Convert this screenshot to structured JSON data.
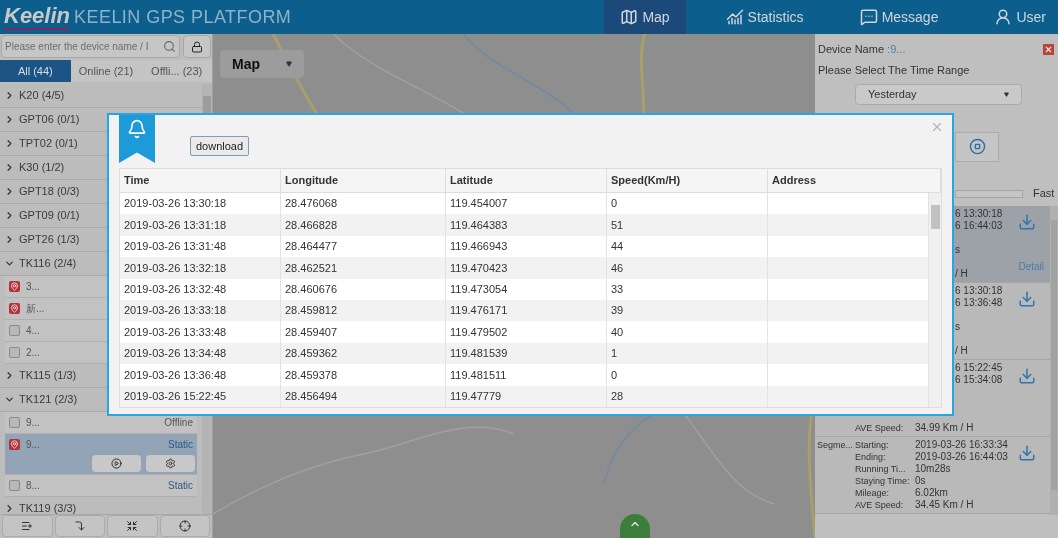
{
  "header": {
    "logo": "Keelin",
    "title": "KEELIN GPS PLATFORM",
    "nav": [
      {
        "label": "Map",
        "selected": true
      },
      {
        "label": "Statistics",
        "selected": false
      },
      {
        "label": "Message",
        "selected": false
      },
      {
        "label": "User",
        "selected": false
      }
    ]
  },
  "sidebar": {
    "search": {
      "placeholder": "Please enter the device name / I"
    },
    "tabs": [
      {
        "label": "All (44)",
        "selected": true
      },
      {
        "label": "Online (21)",
        "selected": false
      },
      {
        "label": "Offli... (23)",
        "selected": false
      }
    ],
    "groups": [
      {
        "label": "K20 (4/5)",
        "expanded": false
      },
      {
        "label": "GPT06 (0/1)",
        "expanded": false
      },
      {
        "label": "TPT02 (0/1)",
        "expanded": false
      },
      {
        "label": "K30 (1/2)",
        "expanded": false
      },
      {
        "label": "GPT18 (0/3)",
        "expanded": false
      },
      {
        "label": "GPT09 (0/1)",
        "expanded": false
      },
      {
        "label": "GPT26 (1/3)",
        "expanded": false
      },
      {
        "label": "TK116 (2/4)",
        "expanded": true,
        "children": [
          {
            "label": "3...",
            "checked": true,
            "selected": false
          },
          {
            "label": "新...",
            "checked": true,
            "selected": false
          },
          {
            "label": "4...",
            "checked": false,
            "selected": false
          },
          {
            "label": "2...",
            "checked": false,
            "selected": false
          }
        ]
      },
      {
        "label": "TK115 (1/3)",
        "expanded": false
      },
      {
        "label": "TK121 (2/3)",
        "expanded": true,
        "children": [
          {
            "label": "9...",
            "checked": false,
            "selected": false,
            "status": "Offline",
            "color": "#555555"
          },
          {
            "label": "9...",
            "checked": true,
            "selected": true,
            "status": "Static",
            "color": "#2a5a88"
          },
          {
            "label": "8...",
            "checked": false,
            "selected": false,
            "status": "Static",
            "color": "#2a5a88"
          }
        ]
      },
      {
        "label": "TK119 (3/3)",
        "expanded": false
      }
    ]
  },
  "map": {
    "type_select": "Map"
  },
  "track_panel": {
    "device_label": "Device Name",
    "device_value": ":9...",
    "time_range_label": "Please Select The Time Range",
    "time_range": "Yesterday",
    "speed_label": "Fast",
    "speed_slider": {
      "level": 0
    },
    "segments": [
      {
        "kind": "covered",
        "selected": true,
        "rows": [
          {
            "value": "6 13:30:18"
          },
          {
            "value": "6 16:44:03"
          },
          {},
          {
            "value": "s"
          },
          {},
          {
            "value": "/ H"
          }
        ],
        "detail": "Detail"
      },
      {
        "kind": "covered",
        "selected": false,
        "rows": [
          {
            "value": "6 13:30:18"
          },
          {
            "value": "6 13:36:48"
          },
          {},
          {
            "value": "s"
          },
          {},
          {
            "value": "/ H"
          }
        ]
      },
      {
        "kind": "covered",
        "selected": false,
        "rows": [
          {
            "value": "6 15:22:45"
          },
          {
            "value": "6 15:34:08"
          },
          {},
          {},
          {},
          {
            "label": "AVE Speed:",
            "value": "34.99 Km / H"
          }
        ]
      },
      {
        "kind": "full",
        "selected": false,
        "title": "Segme...",
        "rows": [
          {
            "label": "Starting:",
            "value": "2019-03-26 16:33:34"
          },
          {
            "label": "Ending:",
            "value": "2019-03-26 16:44:03"
          },
          {
            "label": "Running Ti...",
            "value": "10m28s"
          },
          {
            "label": "Staying Time:",
            "value": "0s"
          },
          {
            "label": "Mileage:",
            "value": "6.02km"
          },
          {
            "label": "AVE Speed:",
            "value": "34.45 Km / H"
          }
        ]
      }
    ]
  },
  "dialog": {
    "download_button": "download",
    "table": {
      "columns": [
        "Time",
        "Longitude",
        "Latitude",
        "Speed(Km/H)",
        "Address"
      ],
      "rows": [
        [
          "2019-03-26 13:30:18",
          "28.476068",
          "119.454007",
          "0"
        ],
        [
          "2019-03-26 13:31:18",
          "28.466828",
          "119.464383",
          "51"
        ],
        [
          "2019-03-26 13:31:48",
          "28.464477",
          "119.466943",
          "44"
        ],
        [
          "2019-03-26 13:32:18",
          "28.462521",
          "119.470423",
          "46"
        ],
        [
          "2019-03-26 13:32:48",
          "28.460676",
          "119.473054",
          "33"
        ],
        [
          "2019-03-26 13:33:18",
          "28.459812",
          "119.476171",
          "39"
        ],
        [
          "2019-03-26 13:33:48",
          "28.459407",
          "119.479502",
          "40"
        ],
        [
          "2019-03-26 13:34:48",
          "28.459362",
          "119.481539",
          "1"
        ],
        [
          "2019-03-26 13:36:48",
          "28.459378",
          "119.481511",
          "0"
        ],
        [
          "2019-03-26 15:22:45",
          "28.456494",
          "119.47779",
          "28"
        ]
      ]
    }
  }
}
